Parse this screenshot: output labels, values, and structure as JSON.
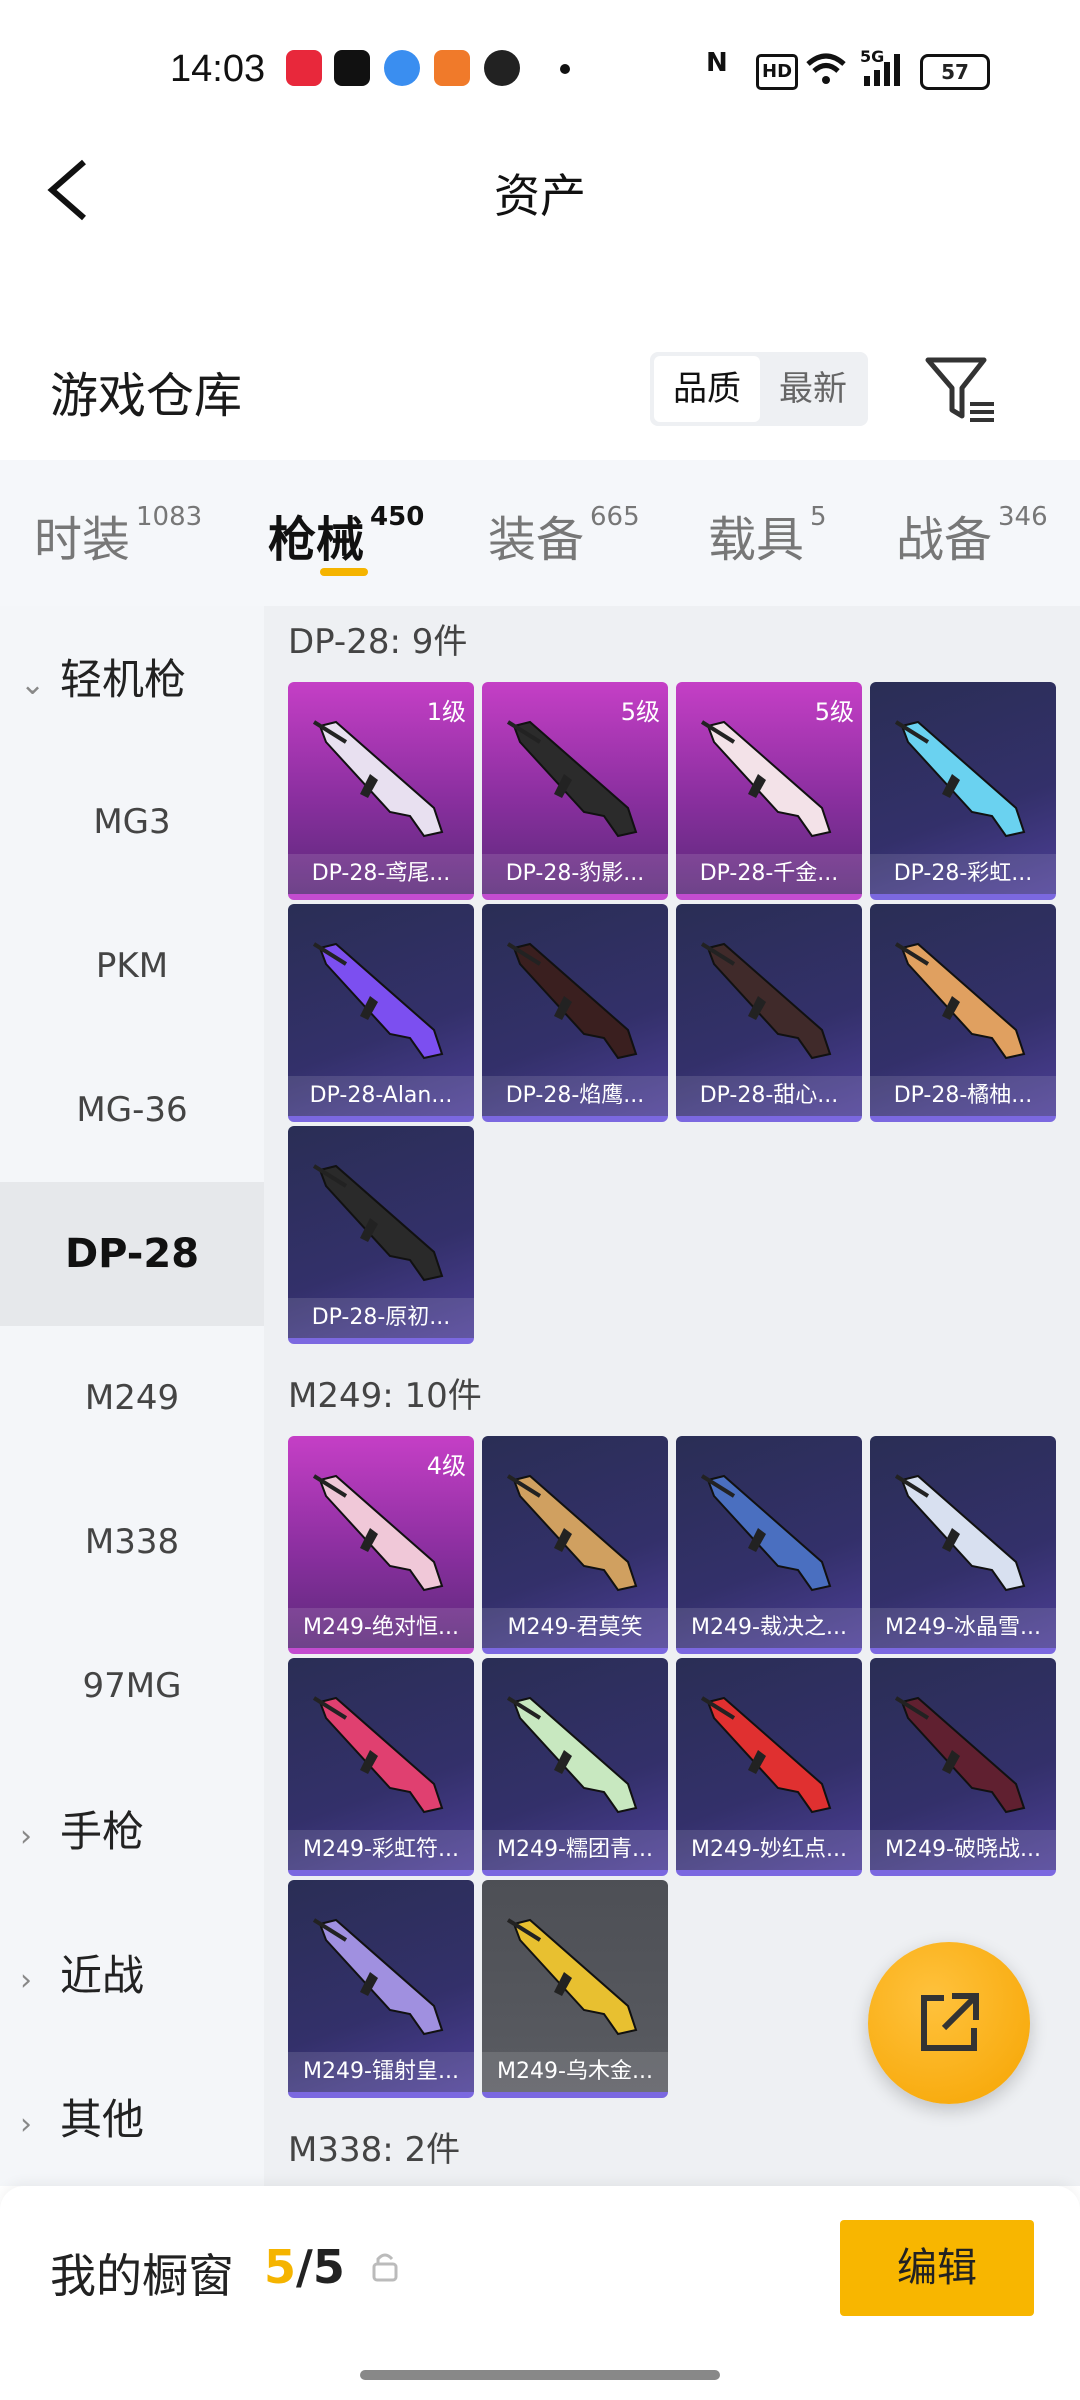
{
  "status": {
    "time": "14:03",
    "battery": "57",
    "icons": [
      "music-app-icon",
      "tiktok-icon",
      "browser-icon",
      "game-app-icon",
      "wechat-icon",
      "nfc-icon",
      "hd-icon",
      "wifi-icon",
      "5g-signal-icon",
      "battery-icon"
    ]
  },
  "nav": {
    "title": "资产"
  },
  "section": {
    "title": "游戏仓库",
    "sort_quality": "品质",
    "sort_latest": "最新"
  },
  "tabs": [
    {
      "label": "时装",
      "count": "1083"
    },
    {
      "label": "枪械",
      "count": "450"
    },
    {
      "label": "装备",
      "count": "665"
    },
    {
      "label": "载具",
      "count": "5"
    },
    {
      "label": "战备",
      "count": "346"
    }
  ],
  "sidebar": {
    "group_lmg": "轻机枪",
    "items": [
      "MG3",
      "PKM",
      "MG-36",
      "DP-28",
      "M249",
      "M338",
      "97MG"
    ],
    "group_pistol": "手枪",
    "group_melee": "近战",
    "group_other": "其他"
  },
  "groups": [
    {
      "title": "DP-28: 9件",
      "cards": [
        {
          "name": "DP-28-鸢尾...",
          "level": "1级",
          "style": "purple"
        },
        {
          "name": "DP-28-豹影...",
          "level": "5级",
          "style": "purple"
        },
        {
          "name": "DP-28-千金...",
          "level": "5级",
          "style": "purple"
        },
        {
          "name": "DP-28-彩虹...",
          "level": "",
          "style": "blue"
        },
        {
          "name": "DP-28-Alan...",
          "level": "",
          "style": "blue"
        },
        {
          "name": "DP-28-焰鹰...",
          "level": "",
          "style": "blue"
        },
        {
          "name": "DP-28-甜心...",
          "level": "",
          "style": "blue"
        },
        {
          "name": "DP-28-橘柚...",
          "level": "",
          "style": "blue"
        },
        {
          "name": "DP-28-原初...",
          "level": "",
          "style": "blue"
        }
      ]
    },
    {
      "title": "M249: 10件",
      "cards": [
        {
          "name": "M249-绝对恒...",
          "level": "4级",
          "style": "purple"
        },
        {
          "name": "M249-君莫笑",
          "level": "",
          "style": "blue"
        },
        {
          "name": "M249-裁决之...",
          "level": "",
          "style": "blue"
        },
        {
          "name": "M249-冰晶雪...",
          "level": "",
          "style": "blue"
        },
        {
          "name": "M249-彩虹符...",
          "level": "",
          "style": "blue"
        },
        {
          "name": "M249-糯团青...",
          "level": "",
          "style": "blue"
        },
        {
          "name": "M249-妙红点...",
          "level": "",
          "style": "blue"
        },
        {
          "name": "M249-破晓战...",
          "level": "",
          "style": "blue"
        },
        {
          "name": "M249-镭射皇...",
          "level": "",
          "style": "blue"
        },
        {
          "name": "M249-乌木金...",
          "level": "",
          "style": "gray"
        }
      ]
    },
    {
      "title": "M338: 2件",
      "cards": []
    }
  ],
  "bottom": {
    "label": "我的橱窗",
    "count_used": "5",
    "count_sep_total": "/5",
    "edit": "编辑"
  },
  "colors": {
    "accent": "#f5b400",
    "purple_card": "#c53fc6",
    "blue_card": "#33306a"
  }
}
